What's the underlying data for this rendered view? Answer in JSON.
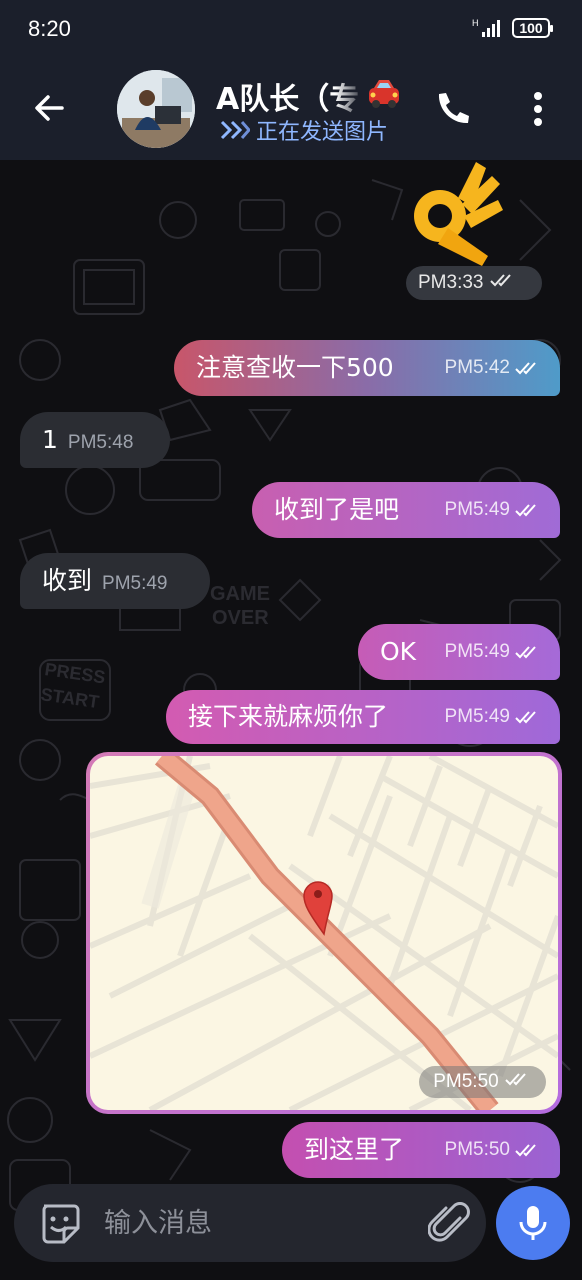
{
  "status_bar": {
    "time": "8:20",
    "battery": "100"
  },
  "header": {
    "title": "A队长（专",
    "status": "正在发送图片"
  },
  "messages": [
    {
      "type": "emoji",
      "emoji": "👌",
      "time": "PM3:33"
    },
    {
      "type": "out",
      "text": "注意查收一下500",
      "time": "PM5:42"
    },
    {
      "type": "in",
      "text": "1",
      "time": "PM5:48"
    },
    {
      "type": "out",
      "text": "收到了是吧",
      "time": "PM5:49"
    },
    {
      "type": "in",
      "text": "收到",
      "time": "PM5:49"
    },
    {
      "type": "out",
      "text": "OK",
      "time": "PM5:49"
    },
    {
      "type": "out",
      "text": "接下来就麻烦你了",
      "time": "PM5:49"
    },
    {
      "type": "map",
      "time": "PM5:50"
    },
    {
      "type": "out",
      "text": "到这里了",
      "time": "PM5:50"
    }
  ],
  "input": {
    "placeholder": "输入消息"
  },
  "colors": {
    "header_bg": "#1b1f2b",
    "incoming_bubble": "#2b2d33",
    "mic_button": "#4c7cf0",
    "status_text": "#8fb7ff"
  },
  "icons": [
    "back-arrow-icon",
    "car-emoji-icon",
    "double-chevron-icon",
    "phone-icon",
    "more-vert-icon",
    "sticker-icon",
    "paperclip-icon",
    "microphone-icon",
    "double-check-icon",
    "map-pin-icon"
  ]
}
